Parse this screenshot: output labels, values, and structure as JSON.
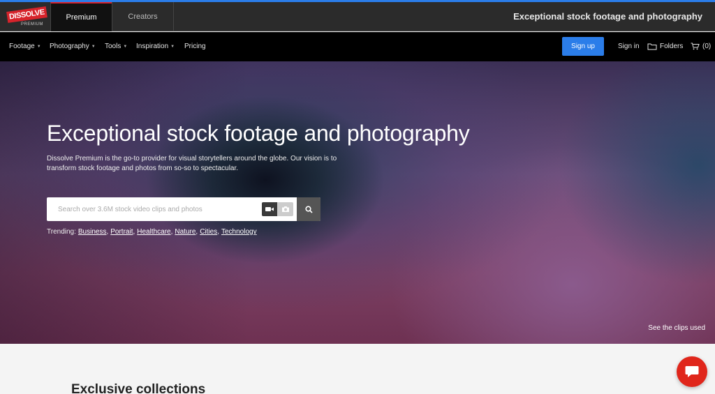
{
  "brand": {
    "logo_main": "DISSOLVE",
    "logo_sub": "PREMIUM",
    "brand_color": "#d7232b",
    "accent_color": "#2b7de9"
  },
  "topbar": {
    "tabs": [
      {
        "label": "Premium",
        "active": true
      },
      {
        "label": "Creators",
        "active": false
      }
    ],
    "title": "Exceptional stock footage and photography"
  },
  "nav": {
    "items": [
      {
        "label": "Footage",
        "dropdown": true
      },
      {
        "label": "Photography",
        "dropdown": true
      },
      {
        "label": "Tools",
        "dropdown": true
      },
      {
        "label": "Inspiration",
        "dropdown": true
      },
      {
        "label": "Pricing",
        "dropdown": false
      }
    ],
    "signup_label": "Sign up",
    "signin_label": "Sign in",
    "folders_label": "Folders",
    "cart_label": "(0)",
    "icons": {
      "folders": "folder-icon",
      "cart": "cart-icon"
    }
  },
  "hero": {
    "title": "Exceptional stock footage and photography",
    "description": "Dissolve Premium is the go-to provider for visual storytellers around the globe. Our vision is to transform stock footage and photos from so-so to spectacular.",
    "search": {
      "placeholder": "Search over 3.6M stock video clips and photos",
      "value": "",
      "icons": {
        "video": "video-camera-icon",
        "photo": "camera-icon",
        "submit": "search-icon"
      }
    },
    "trending": {
      "label": "Trending:",
      "items": [
        "Business",
        "Portrait",
        "Healthcare",
        "Nature",
        "Cities",
        "Technology"
      ]
    },
    "see_clips_label": "See the clips used"
  },
  "section": {
    "title": "Exclusive collections"
  },
  "chat": {
    "icon": "chat-icon",
    "color": "#e0261b"
  }
}
